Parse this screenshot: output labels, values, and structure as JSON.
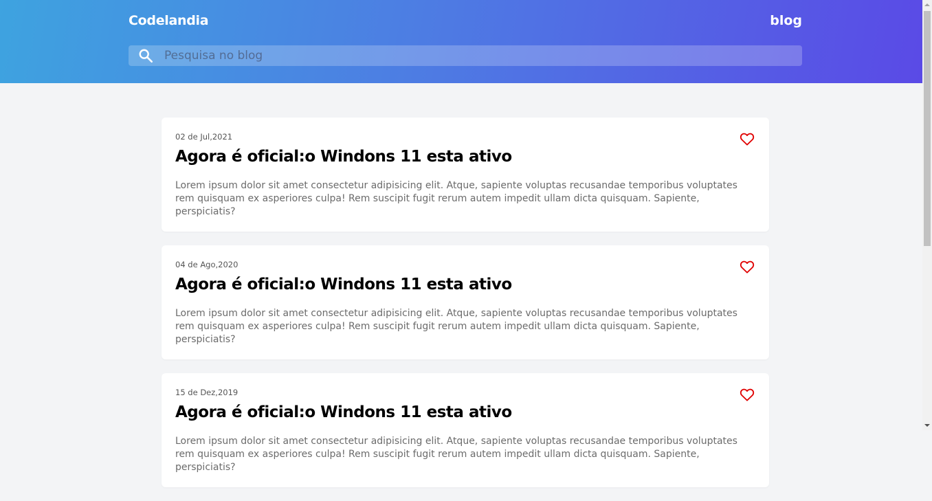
{
  "header": {
    "brand": "Codelandia",
    "nav_link": "blog",
    "search": {
      "placeholder": "Pesquisa no blog",
      "icon": "search-icon"
    },
    "gradient": [
      "#3ea3e0",
      "#5a4ae6"
    ]
  },
  "posts": [
    {
      "date": "02 de Jul,2021",
      "title": "Agora é oficial:o Windons 11 esta ativo",
      "excerpt": "Lorem ipsum dolor sit amet consectetur adipisicing elit. Atque, sapiente voluptas recusandae temporibus voluptates rem quisquam ex asperiores culpa! Rem suscipit fugit rerum autem impedit ullam dicta quisquam. Sapiente, perspiciatis?",
      "like_icon": "heart-icon"
    },
    {
      "date": "04 de Ago,2020",
      "title": "Agora é oficial:o Windons 11 esta ativo",
      "excerpt": "Lorem ipsum dolor sit amet consectetur adipisicing elit. Atque, sapiente voluptas recusandae temporibus voluptates rem quisquam ex asperiores culpa! Rem suscipit fugit rerum autem impedit ullam dicta quisquam. Sapiente, perspiciatis?",
      "like_icon": "heart-icon"
    },
    {
      "date": "15 de Dez,2019",
      "title": "Agora é oficial:o Windons 11 esta ativo",
      "excerpt": "Lorem ipsum dolor sit amet consectetur adipisicing elit. Atque, sapiente voluptas recusandae temporibus voluptates rem quisquam ex asperiores culpa! Rem suscipit fugit rerum autem impedit ullam dicta quisquam. Sapiente, perspiciatis?",
      "like_icon": "heart-icon"
    }
  ],
  "colors": {
    "heart": "#e00000",
    "page_bg": "#f3f4f6"
  }
}
